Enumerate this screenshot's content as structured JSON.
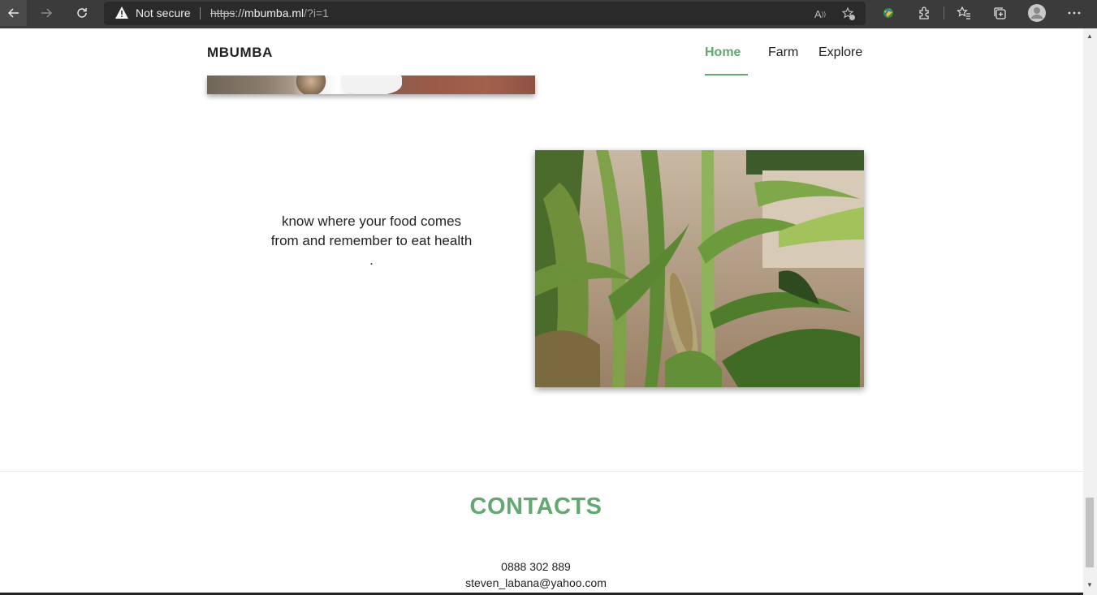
{
  "browser": {
    "security_label": "Not secure",
    "url_scheme": "https",
    "url_sep": "://",
    "url_host": "mbumba.ml",
    "url_path": "/?i=1"
  },
  "nav": {
    "brand": "MBUMBA",
    "links": [
      {
        "label": "Home",
        "active": true
      },
      {
        "label": "Farm",
        "active": false
      },
      {
        "label": "Explore",
        "active": false
      }
    ]
  },
  "main": {
    "tagline": "know where your food comes from and remember to eat health ."
  },
  "contacts": {
    "title": "CONTACTS",
    "phone": "0888 302 889",
    "email": "steven_labana@yahoo.com"
  },
  "colors": {
    "accent": "#62a86f",
    "chrome": "#3b3b3b"
  }
}
